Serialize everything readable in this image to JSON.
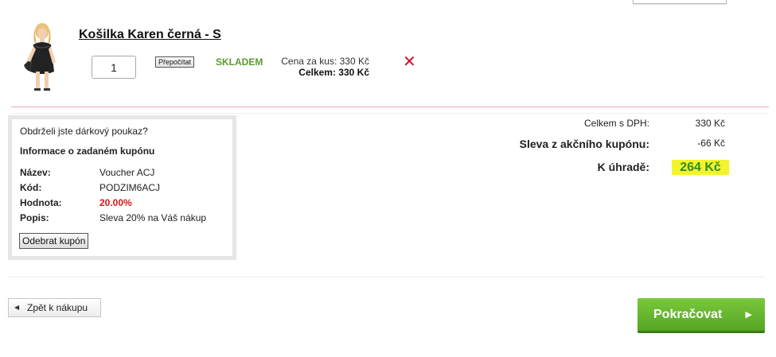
{
  "product": {
    "title": "Košilka Karen černá - S",
    "quantity": "1",
    "recalc_label": "Přepočítat",
    "stock_status": "SKLADEM",
    "unit_price": "Cena za kus: 330 Kč",
    "total_price": "Celkem: 330 Kč",
    "remove_icon": "close-icon"
  },
  "coupon": {
    "question": "Obdrželi jste dárkový poukaz?",
    "heading": "Informace o zadaném kupónu",
    "fields": [
      {
        "label": "Název:",
        "value": "Voucher ACJ"
      },
      {
        "label": "Kód:",
        "value": "PODZIM6ACJ"
      },
      {
        "label": "Hodnota:",
        "value": "20.00%"
      },
      {
        "label": "Popis:",
        "value": "Sleva 20% na Váš nákup"
      }
    ],
    "remove_button": "Odebrat kupón"
  },
  "summary": {
    "total_vat_label": "Celkem s DPH:",
    "total_vat_value": "330 Kč",
    "discount_label": "Sleva z akčního kupónu:",
    "discount_value": "-66 Kč",
    "to_pay_label": "K úhradě:",
    "to_pay_value": "264 Kč"
  },
  "footer": {
    "back_label": "Zpět k nákupu",
    "continue_label": "Pokračovat"
  },
  "colors": {
    "stock_green": "#5a9a2c",
    "remove_red": "#c8102e",
    "highlight_yellow": "#f4f42c",
    "total_green": "#2e8f1e",
    "continue_green": "#62b12c"
  }
}
